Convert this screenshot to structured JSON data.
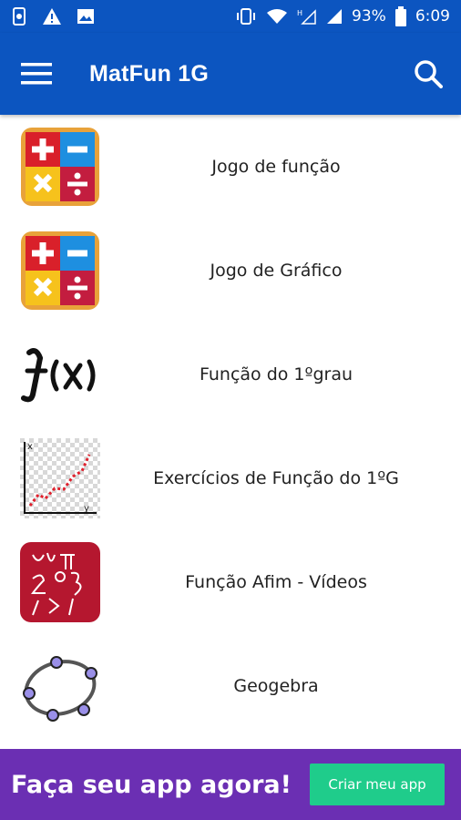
{
  "status_bar": {
    "icons_left": [
      "app-notification-icon",
      "warning-icon",
      "image-icon"
    ],
    "icons_right": [
      "vibrate-icon",
      "wifi-icon",
      "no-signal-icon",
      "signal-icon"
    ],
    "battery": "93%",
    "time": "6:09"
  },
  "app_bar": {
    "title": "MatFun 1G",
    "menu_icon": "hamburger-menu-icon",
    "search_icon": "search-icon",
    "color": "#0c55c0"
  },
  "items": [
    {
      "label": "Jogo de função",
      "icon": "math-operations-icon"
    },
    {
      "label": "Jogo de Gráfico",
      "icon": "math-operations-icon"
    },
    {
      "label": "Função do 1ºgrau",
      "icon": "function-fx-icon"
    },
    {
      "label": "Exercícios de Função do 1ºG",
      "icon": "line-graph-icon"
    },
    {
      "label": "Função Afim - Vídeos",
      "icon": "math-chalkboard-icon"
    },
    {
      "label": "Geogebra",
      "icon": "geogebra-icon"
    }
  ],
  "ad": {
    "text": "Faça seu app agora!",
    "button_label": "Criar meu app",
    "background": "#6b2fb3",
    "button_color": "#1fcc8b"
  }
}
